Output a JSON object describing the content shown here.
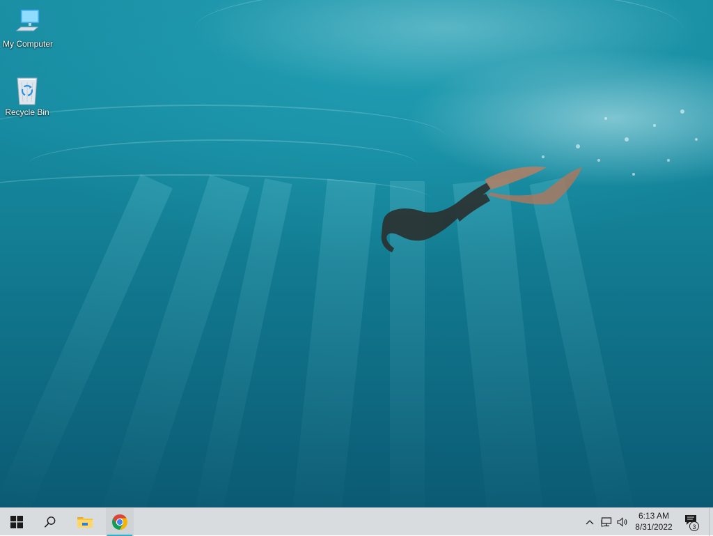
{
  "desktop": {
    "icons": [
      {
        "label": "My Computer",
        "icon": "computer-icon"
      },
      {
        "label": "Recycle Bin",
        "icon": "recycle-bin-icon"
      }
    ],
    "wallpaper": "underwater-freediver",
    "colors": {
      "water_top": "#1a8ea3",
      "water_bottom": "#0b5a73"
    }
  },
  "taskbar": {
    "start": {
      "icon": "windows-logo-icon"
    },
    "search": {
      "icon": "search-icon"
    },
    "pinned": [
      {
        "name": "File Explorer",
        "icon": "file-explorer-icon"
      },
      {
        "name": "Google Chrome",
        "icon": "chrome-icon",
        "active": true
      }
    ],
    "tray": {
      "chevron": {
        "icon": "chevron-up-icon"
      },
      "network": {
        "icon": "network-icon"
      },
      "volume": {
        "icon": "speaker-icon"
      },
      "time": "6:13 AM",
      "date": "8/31/2022",
      "notifications": {
        "icon": "action-center-icon",
        "count": "3"
      }
    },
    "colors": {
      "background": "#d9dcdf",
      "active_indicator": "#2bb1c9"
    }
  }
}
